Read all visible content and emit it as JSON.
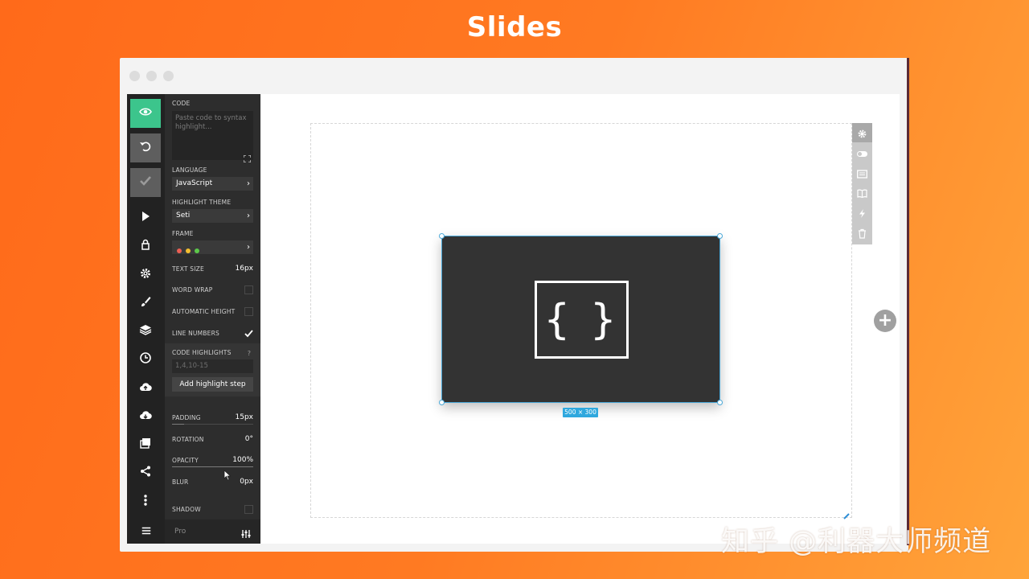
{
  "page": {
    "title": "Slides"
  },
  "panel": {
    "code_label": "CODE",
    "code_placeholder": "Paste code to syntax highlight...",
    "language_label": "LANGUAGE",
    "language_value": "JavaScript",
    "theme_label": "HIGHLIGHT THEME",
    "theme_value": "Seti",
    "frame_label": "FRAME",
    "text_size_label": "TEXT SIZE",
    "text_size_value": "16px",
    "word_wrap_label": "WORD WRAP",
    "auto_height_label": "AUTOMATIC HEIGHT",
    "line_numbers_label": "LINE NUMBERS",
    "code_highlights_label": "CODE HIGHLIGHTS",
    "help_mark": "?",
    "highlights_placeholder": "1,4,10-15",
    "add_highlight_label": "Add highlight step",
    "padding_label": "PADDING",
    "padding_value": "15px",
    "rotation_label": "ROTATION",
    "rotation_value": "0°",
    "opacity_label": "OPACITY",
    "opacity_value": "100%",
    "blur_label": "BLUR",
    "blur_value": "0px",
    "shadow_label": "SHADOW",
    "pro_label": "Pro"
  },
  "settings_state": {
    "word_wrap": false,
    "automatic_height": false,
    "line_numbers": true,
    "shadow": false,
    "opacity_level": 1.0,
    "padding_level": 0.15
  },
  "canvas": {
    "size_badge": "500 × 300",
    "block_symbol": "{ }",
    "add_symbol": "+"
  },
  "watermark": "知乎 @利器大师频道",
  "colors": {
    "accent_green": "#3cc58c",
    "selection_blue": "#2fa8de",
    "panel_bg": "#2d2d2d",
    "icon_bar_bg": "#222222"
  },
  "icons": {
    "icon_bar": [
      "eye-icon",
      "undo-icon",
      "check-icon",
      "play-icon",
      "lock-icon",
      "gear-icon",
      "brush-icon",
      "layers-icon",
      "clock-icon",
      "cloud-upload-icon",
      "cloud-download-icon",
      "images-icon",
      "share-icon",
      "more-icon",
      "menu-icon"
    ],
    "tool_strip": [
      "gear-icon",
      "toggle-icon",
      "screen-icon",
      "book-icon",
      "lightning-icon",
      "trash-icon"
    ]
  }
}
